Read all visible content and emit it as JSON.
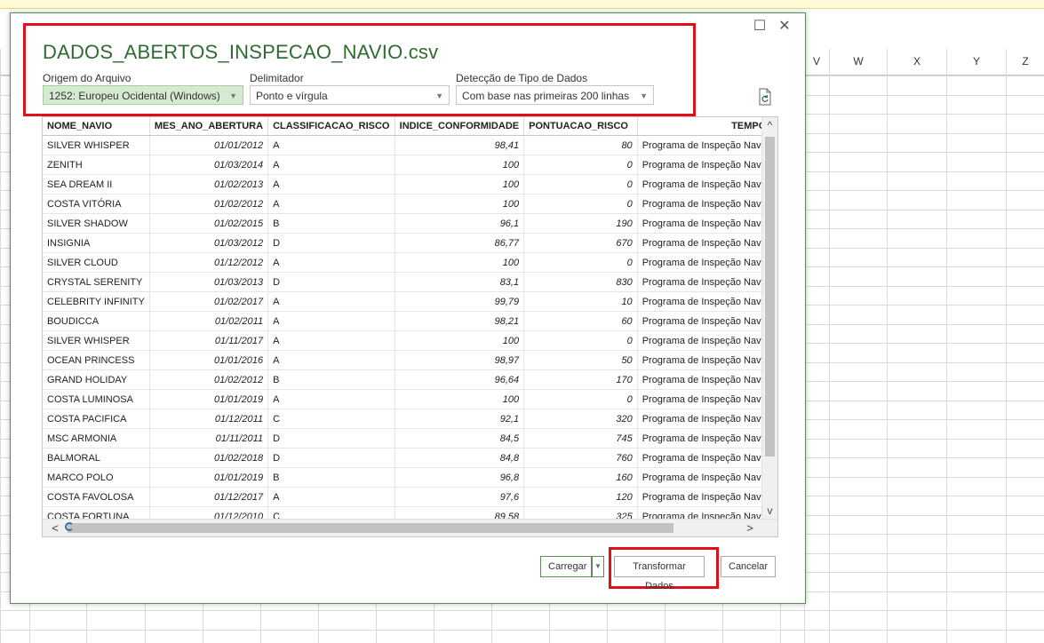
{
  "sheet": {
    "column_headers": [
      "V",
      "W",
      "X",
      "Y",
      "Z"
    ]
  },
  "dialog": {
    "title": "DADOS_ABERTOS_INSPECAO_NAVIO.csv",
    "file_origin": {
      "label": "Origem do Arquivo",
      "value": "1252: Europeu Ocidental (Windows)"
    },
    "delimiter": {
      "label": "Delimitador",
      "value": "Ponto e vírgula"
    },
    "type_detection": {
      "label": "Detecção de Tipo de Dados",
      "value": "Com base nas primeiras 200 linhas"
    },
    "refresh_icon": "refresh-preview-icon",
    "buttons": {
      "load": "Carregar",
      "transform": "Transformar Dados",
      "cancel": "Cancelar"
    },
    "window_controls": {
      "maximize": "☐",
      "close": "✕"
    },
    "highlight_color": "#e0101a",
    "accent_color": "#2f6b31"
  },
  "table": {
    "columns": [
      "NOME_NAVIO",
      "MES_ANO_ABERTURA",
      "CLASSIFICACAO_RISCO",
      "INDICE_CONFORMIDADE",
      "PONTUACAO_RISCO",
      "TEMPOF"
    ],
    "rows": [
      [
        "SILVER WHISPER",
        "01/01/2012",
        "A",
        "98,41",
        "80",
        "Programa de Inspeção Navic"
      ],
      [
        "ZENITH",
        "01/03/2014",
        "A",
        "100",
        "0",
        "Programa de Inspeção Navic"
      ],
      [
        "SEA DREAM II",
        "01/02/2013",
        "A",
        "100",
        "0",
        "Programa de Inspeção Navic"
      ],
      [
        "COSTA VITÓRIA",
        "01/02/2012",
        "A",
        "100",
        "0",
        "Programa de Inspeção Navic"
      ],
      [
        "SILVER SHADOW",
        "01/02/2015",
        "B",
        "96,1",
        "190",
        "Programa de Inspeção Navic"
      ],
      [
        "INSIGNIA",
        "01/03/2012",
        "D",
        "86,77",
        "670",
        "Programa de Inspeção Navic"
      ],
      [
        "SILVER CLOUD",
        "01/12/2012",
        "A",
        "100",
        "0",
        "Programa de Inspeção Navic"
      ],
      [
        "CRYSTAL SERENITY",
        "01/03/2013",
        "D",
        "83,1",
        "830",
        "Programa de Inspeção Navic"
      ],
      [
        "CELEBRITY INFINITY",
        "01/02/2017",
        "A",
        "99,79",
        "10",
        "Programa de Inspeção Navic"
      ],
      [
        "BOUDICCA",
        "01/02/2011",
        "A",
        "98,21",
        "60",
        "Programa de Inspeção Navic"
      ],
      [
        "SILVER WHISPER",
        "01/11/2017",
        "A",
        "100",
        "0",
        "Programa de Inspeção Navic"
      ],
      [
        "OCEAN PRINCESS",
        "01/01/2016",
        "A",
        "98,97",
        "50",
        "Programa de Inspeção Navic"
      ],
      [
        "GRAND HOLIDAY",
        "01/02/2012",
        "B",
        "96,64",
        "170",
        "Programa de Inspeção Navic"
      ],
      [
        "COSTA LUMINOSA",
        "01/01/2019",
        "A",
        "100",
        "0",
        "Programa de Inspeção Navic"
      ],
      [
        "COSTA PACIFICA",
        "01/12/2011",
        "C",
        "92,1",
        "320",
        "Programa de Inspeção Navic"
      ],
      [
        "MSC ARMONIA",
        "01/11/2011",
        "D",
        "84,5",
        "745",
        "Programa de Inspeção Navic"
      ],
      [
        "BALMORAL",
        "01/02/2018",
        "D",
        "84,8",
        "760",
        "Programa de Inspeção Navic"
      ],
      [
        "MARCO POLO",
        "01/01/2019",
        "B",
        "96,8",
        "160",
        "Programa de Inspeção Navic"
      ],
      [
        "COSTA FAVOLOSA",
        "01/12/2017",
        "A",
        "97,6",
        "120",
        "Programa de Inspeção Navic"
      ],
      [
        "COSTA FORTUNA",
        "01/12/2010",
        "C",
        "89,58",
        "325",
        "Programa de Inspeção Navic"
      ]
    ]
  }
}
